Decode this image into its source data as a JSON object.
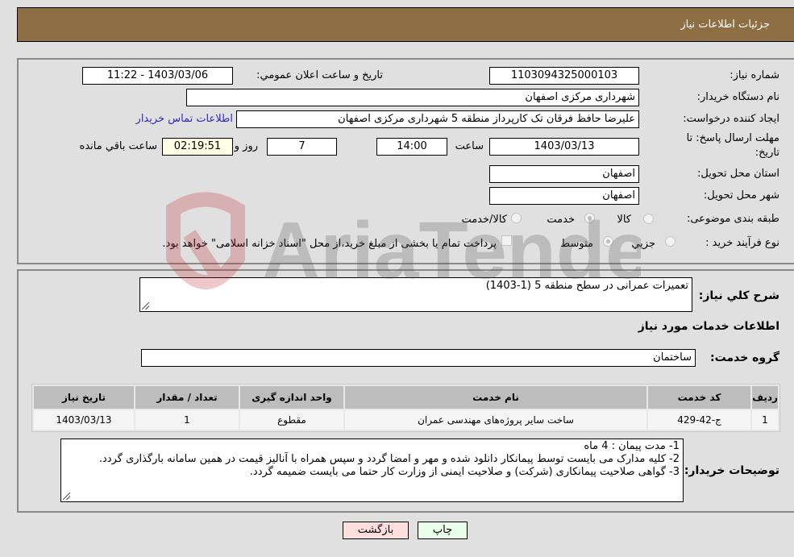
{
  "header": {
    "title": "جزئیات اطلاعات نیاز"
  },
  "info": {
    "need_number_label": "شماره نیاز:",
    "need_number": "1103094325000103",
    "announce_label": "تاریخ و ساعت اعلان عمومي:",
    "announce_value": "1403/03/06 - 11:22",
    "buyer_org_label": "نام دستگاه خریدار:",
    "buyer_org": "شهرداری مرکزی اصفهان",
    "creator_label": "ایجاد کننده درخواست:",
    "creator": "علیرضا حافظ فرقان تک کارپرداز منطقه 5 شهرداری مرکزی اصفهان",
    "contact_link": "اطلاعات تماس خریدار",
    "deadline_label_line1": "مهلت ارسال پاسخ: تا",
    "deadline_label_line2": "تاریخ:",
    "deadline_date": "1403/03/13",
    "time_label": "ساعت",
    "deadline_time": "14:00",
    "days_value": "7",
    "days_label": "روز و",
    "remaining_time": "02:19:51",
    "remaining_label": "ساعت باقي مانده",
    "province_label": "استان محل تحویل:",
    "province": "اصفهان",
    "city_label": "شهر محل تحویل:",
    "city": "اصفهان",
    "category_label": "طبقه بندی موضوعی:",
    "category_options": [
      {
        "label": "کالا",
        "selected": false
      },
      {
        "label": "خدمت",
        "selected": true
      },
      {
        "label": "کالا/خدمت",
        "selected": false
      }
    ],
    "process_label": "نوع فرآیند خرید :",
    "process_options": [
      {
        "label": "جزيي",
        "selected": false
      },
      {
        "label": "متوسط",
        "selected": true
      }
    ],
    "treasury_note": "پرداخت تمام یا بخشی از مبلغ خرید،از محل \"اسناد خزانه اسلامی\" خواهد بود."
  },
  "details": {
    "summary_label": "شرح کلي نیاز:",
    "summary_value": "تعمیرات عمرانی در سطح منطقه 5 (1-1403)",
    "services_heading": "اطلاعات خدمات مورد نیاز",
    "service_group_label": "گروه خدمت:",
    "service_group": "ساختمان",
    "table": {
      "headers": [
        "ردیف",
        "کد خدمت",
        "نام خدمت",
        "واحد اندازه گیری",
        "تعداد / مقدار",
        "تاریخ نیاز"
      ],
      "rows": [
        [
          "1",
          "ج-42-429",
          "ساخت سایر پروژه‌های مهندسی عمران",
          "مقطوع",
          "1",
          "1403/03/13"
        ]
      ]
    },
    "buyer_notes_label": "توضیحات خریدار:",
    "buyer_notes": [
      "1- مدت پیمان : 4 ماه",
      "2- کلیه مدارک می بایست توسط پیمانکار دانلود شده و مهر و امضا گردد و سپس همراه با آنالیز قیمت در همین سامانه بارگذاری گردد.",
      "3- گواهی صلاحیت پیمانکاری (شرکت) و صلاحیت ایمنی از وزارت کار حتما می بایست ضمیمه گردد."
    ]
  },
  "buttons": {
    "print": "چاپ",
    "back": "بازگشت"
  },
  "watermark": {
    "text": "AriaTender.neT"
  },
  "colors": {
    "header_bg": "#8e6e43",
    "link": "#2a27c9",
    "print_bg": "#eaffea",
    "back_bg": "#ffdede"
  }
}
